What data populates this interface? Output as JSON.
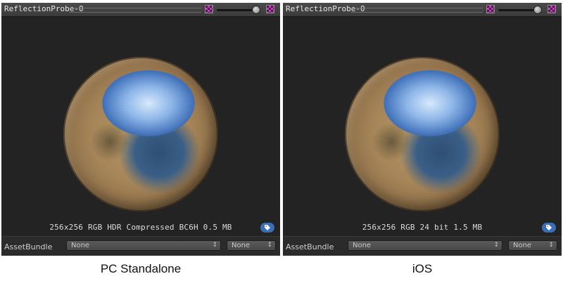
{
  "panels": [
    {
      "title": "ReflectionProbe-0",
      "texture_info": "256x256  RGB HDR Compressed BC6H   0.5 MB",
      "asset_bundle_label": "AssetBundle",
      "asset_bundle_value": "None",
      "asset_variant_value": "None",
      "dropdown_arrow": "↕",
      "caption": "PC Standalone"
    },
    {
      "title": "ReflectionProbe-0",
      "texture_info": "256x256  RGB 24 bit   1.5 MB",
      "asset_bundle_label": "AssetBundle",
      "asset_bundle_value": "None",
      "asset_variant_value": "None",
      "dropdown_arrow": "↕",
      "caption": "iOS"
    }
  ],
  "colors": {
    "panel_bg": "#232323",
    "tag_button": "#3a6fb8",
    "mode_icon": "#c43fc0"
  }
}
